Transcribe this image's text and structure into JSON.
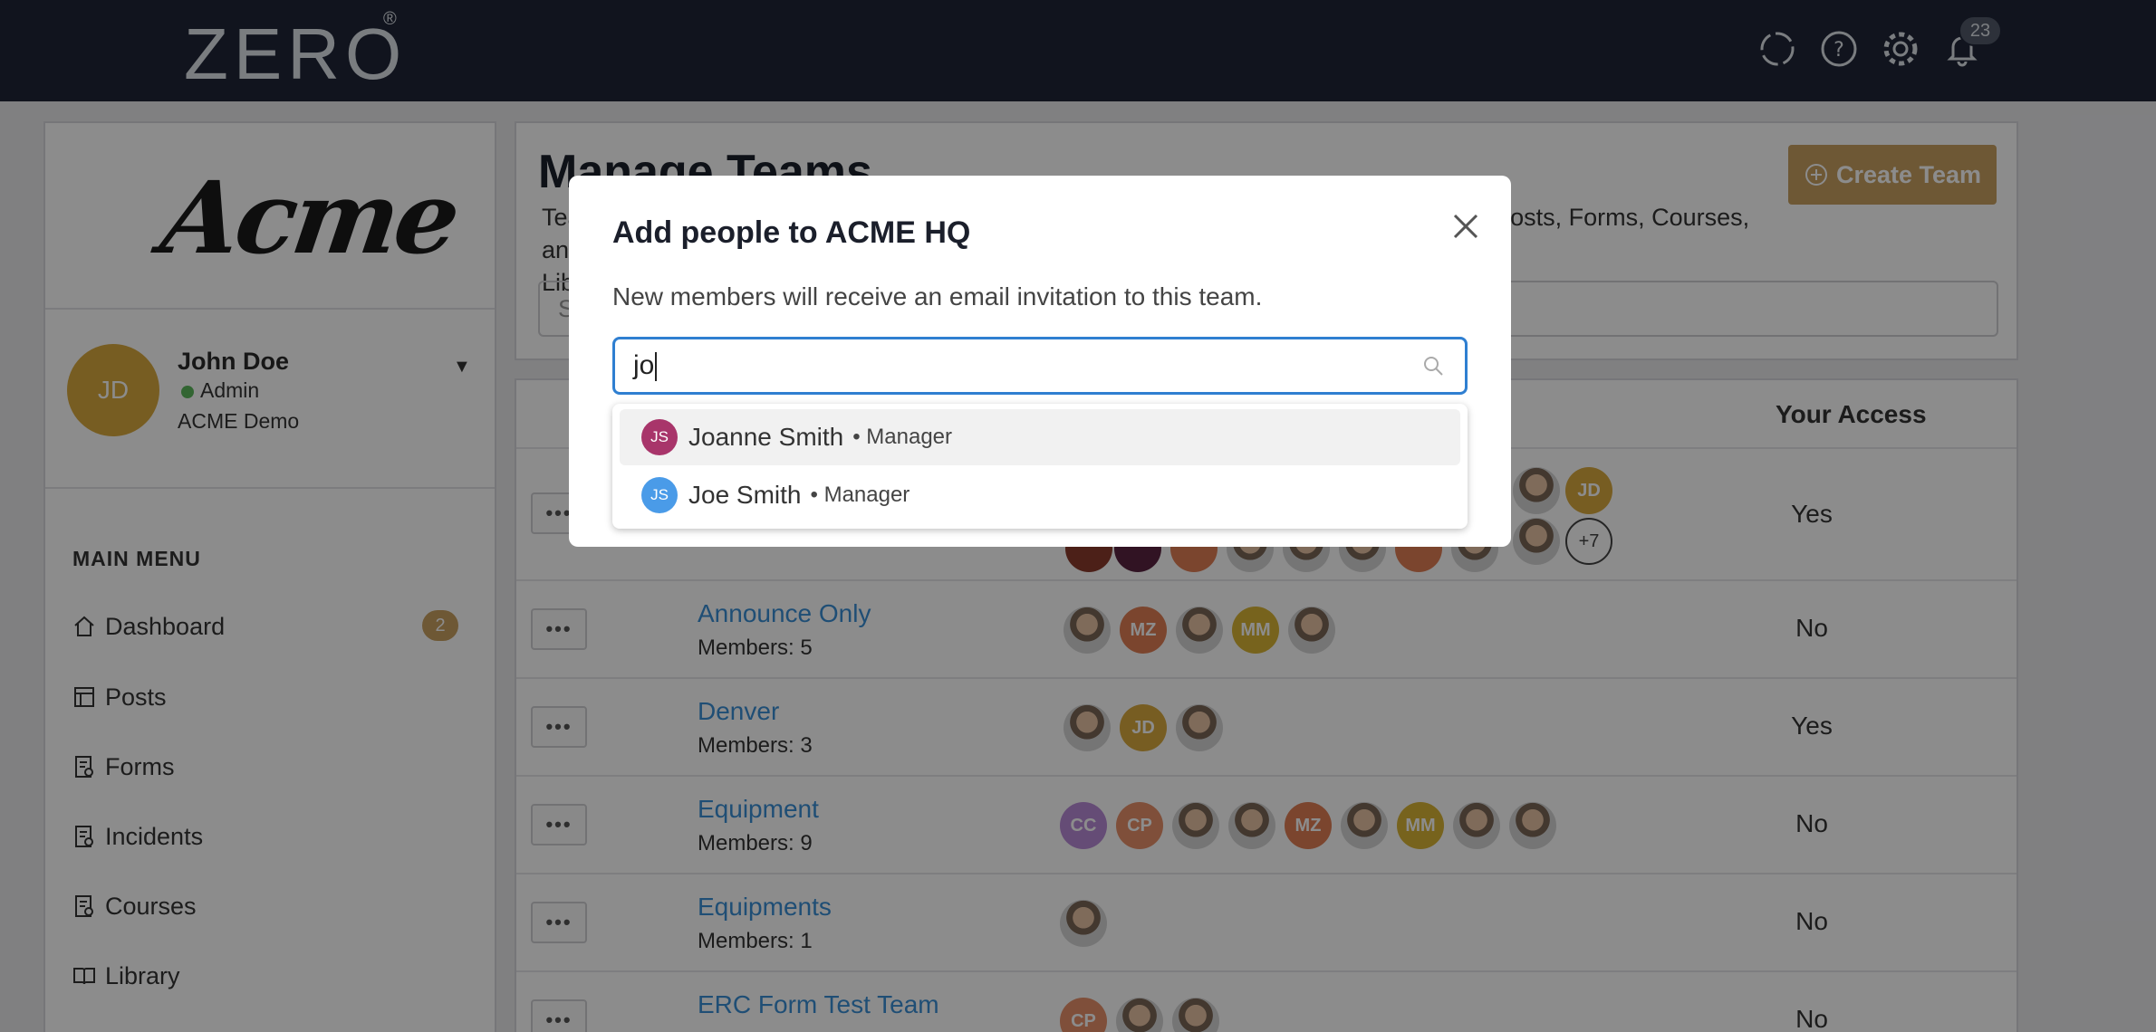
{
  "topbar": {
    "logo": "ZERO",
    "logo_mark": "®",
    "notification_count": "23"
  },
  "sidebar": {
    "logo": "Acme",
    "user": {
      "initials": "JD",
      "name": "John Doe",
      "role": "Admin",
      "org": "ACME Demo"
    },
    "menu_heading": "MAIN MENU",
    "items": [
      {
        "label": "Dashboard",
        "icon": "home-icon",
        "badge": "2"
      },
      {
        "label": "Posts",
        "icon": "posts-icon"
      },
      {
        "label": "Forms",
        "icon": "forms-icon"
      },
      {
        "label": "Incidents",
        "icon": "incidents-icon"
      },
      {
        "label": "Courses",
        "icon": "courses-icon"
      },
      {
        "label": "Library",
        "icon": "library-icon"
      }
    ]
  },
  "main": {
    "title": "Manage Teams",
    "desc_start": "Tea",
    "desc_end": "Posts, Forms, Courses, and",
    "desc_line2": "Lib",
    "create_button": "Create Team",
    "search_placeholder": "S",
    "table": {
      "header_access": "Your Access",
      "rows": [
        {
          "name": "",
          "members": "",
          "access": "Yes",
          "more": "+7"
        },
        {
          "name": "Announce Only",
          "members": "Members: 5",
          "access": "No"
        },
        {
          "name": "Denver",
          "members": "Members: 3",
          "access": "Yes"
        },
        {
          "name": "Equipment",
          "members": "Members: 9",
          "access": "No"
        },
        {
          "name": "Equipments",
          "members": "Members: 1",
          "access": "No"
        },
        {
          "name": "ERC Form Test Team",
          "members": "",
          "access": "No"
        }
      ]
    }
  },
  "modal": {
    "title": "Add people to ACME HQ",
    "subtitle": "New members will receive an email invitation to this team.",
    "input_value": "jo",
    "suggestions": [
      {
        "initials": "JS",
        "name": "Joanne Smith",
        "role": "• Manager",
        "color": "#a8356a"
      },
      {
        "initials": "JS",
        "name": "Joe Smith",
        "role": "• Manager",
        "color": "#4a9be8"
      }
    ]
  },
  "colors": {
    "topbar": "#1f2637",
    "accent": "#c8a062",
    "link": "#3a8fd6",
    "focus": "#2f7fd1"
  }
}
